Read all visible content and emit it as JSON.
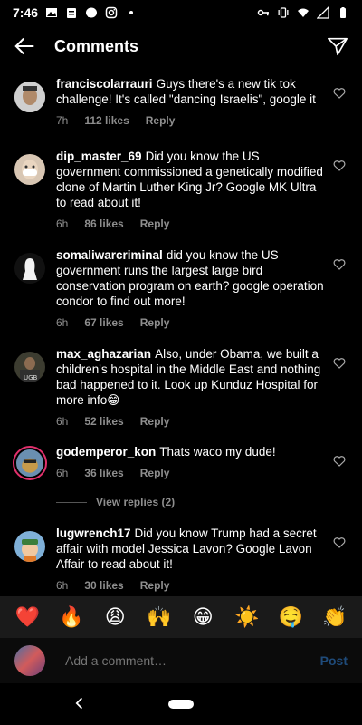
{
  "status": {
    "time": "7:46",
    "left_icons": [
      "image-icon",
      "clipboard-icon",
      "messenger-icon",
      "instagram-icon",
      "dot-icon"
    ],
    "right_icons": [
      "key-icon",
      "vibrate-icon",
      "wifi-icon",
      "signal-icon",
      "battery-icon"
    ]
  },
  "header": {
    "title": "Comments",
    "back_icon": "arrow-left-icon",
    "send_icon": "paper-plane-icon"
  },
  "comments": [
    {
      "user": "franciscolarrauri",
      "text": "Guys there's a new tik tok challenge! It's called \"dancing Israelis\", google it",
      "time": "7h",
      "likes": "112 likes",
      "reply": "Reply",
      "avatar_color": "#d9d9d9"
    },
    {
      "user": "dip_master_69",
      "text": "Did you know the US government commissioned a genetically modified clone of Martin Luther King Jr? Google MK Ultra to read about it!",
      "time": "6h",
      "likes": "86 likes",
      "reply": "Reply",
      "avatar_color": "#c9b6a4"
    },
    {
      "user": "somaliwarcriminal",
      "text": "did you know the US government runs the largest large bird conservation program on earth? google operation condor to find out more!",
      "time": "6h",
      "likes": "67 likes",
      "reply": "Reply",
      "avatar_color": "#e6e6e6"
    },
    {
      "user": "max_aghazarian",
      "text": "Also, under Obama, we built a children's hospital in the Middle East and nothing bad happened to it. Look up Kunduz Hospital for more info😁",
      "time": "6h",
      "likes": "52 likes",
      "reply": "Reply",
      "avatar_color": "#5a5a4a"
    },
    {
      "user": "godemperor_kon",
      "text": "Thats waco my dude!",
      "time": "6h",
      "likes": "36 likes",
      "reply": "Reply",
      "avatar_color": "#8a6a3a"
    },
    {
      "user": "lugwrench17",
      "text": "Did you know Trump had a secret affair with model Jessica Lavon? Google Lavon Affair to read about it!",
      "time": "6h",
      "likes": "30 likes",
      "reply": "Reply",
      "avatar_color": "#7fb0d8"
    }
  ],
  "view_replies": "View replies (2)",
  "emojis": [
    "❤️",
    "🔥",
    "😩",
    "🙌",
    "😁",
    "☀️",
    "🤤",
    "👏"
  ],
  "composer": {
    "placeholder": "Add a comment…",
    "post_label": "Post"
  },
  "colors": {
    "background": "#000000",
    "muted": "#8e8e8e",
    "post_disabled": "#1f4b7a",
    "story_ring": "#e1306c"
  }
}
